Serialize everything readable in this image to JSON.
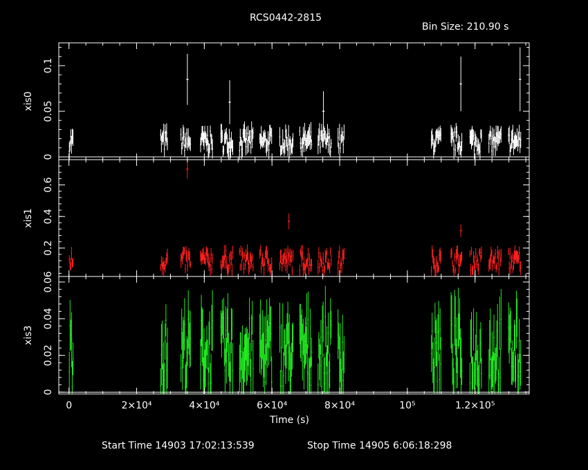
{
  "title": "RCS0442-2815",
  "bin_size_label": "Bin Size: 210.90 s",
  "footer": {
    "start_time": "Start Time 14903 17:02:13:539",
    "stop_time": "Stop Time 14905  6:06:18:298"
  },
  "colors": {
    "axes": "#ffffff",
    "xis0": "#ffffff",
    "xis1": "#ff2020",
    "xis3": "#22ee22"
  },
  "chart_data": {
    "type": "scatter",
    "xlabel": "Time (s)",
    "xlim": [
      -3000,
      136000
    ],
    "x_ticks": [
      {
        "value": 0,
        "label": "0"
      },
      {
        "value": 20000,
        "label": "2×10⁴"
      },
      {
        "value": 40000,
        "label": "4×10⁴"
      },
      {
        "value": 60000,
        "label": "6×10⁴"
      },
      {
        "value": 80000,
        "label": "8×10⁴"
      },
      {
        "value": 100000,
        "label": "10⁵"
      },
      {
        "value": 120000,
        "label": "1.2×10⁵"
      }
    ],
    "segments": [
      [
        0,
        1300
      ],
      [
        27000,
        29200
      ],
      [
        33000,
        36000
      ],
      [
        38800,
        42500
      ],
      [
        44800,
        48500
      ],
      [
        50300,
        54500
      ],
      [
        56300,
        60000
      ],
      [
        62200,
        66300
      ],
      [
        68100,
        71800
      ],
      [
        73500,
        77600
      ],
      [
        79400,
        81400
      ],
      [
        107000,
        110000
      ],
      [
        112800,
        116200
      ],
      [
        118400,
        122000
      ],
      [
        124000,
        127800
      ],
      [
        129800,
        133600
      ]
    ],
    "panels": [
      {
        "name": "xis0",
        "ylabel": "xis0",
        "ylim": [
          -0.003,
          0.125
        ],
        "y_ticks": [
          {
            "value": 0,
            "label": "0"
          },
          {
            "value": 0.05,
            "label": "0.05"
          },
          {
            "value": 0.1,
            "label": "0.1"
          }
        ],
        "mean": 0.017,
        "spread": 0.007,
        "err": 0.008,
        "spikes": [
          {
            "x": 35000,
            "y": 0.085,
            "err": 0.028
          },
          {
            "x": 47500,
            "y": 0.06,
            "err": 0.024
          },
          {
            "x": 75200,
            "y": 0.05,
            "err": 0.022
          },
          {
            "x": 115800,
            "y": 0.08,
            "err": 0.03
          },
          {
            "x": 133300,
            "y": 0.085,
            "err": 0.035
          }
        ]
      },
      {
        "name": "xis1",
        "ylabel": "xis1",
        "ylim": [
          0.02,
          0.76
        ],
        "y_ticks": [
          {
            "value": 0.2,
            "label": "0.2"
          },
          {
            "value": 0.4,
            "label": "0.4"
          },
          {
            "value": 0.6,
            "label": "0.6"
          }
        ],
        "mean": 0.12,
        "spread": 0.04,
        "err": 0.035,
        "spikes": [
          {
            "x": 35000,
            "y": 0.7,
            "err": 0.06
          },
          {
            "x": 65000,
            "y": 0.37,
            "err": 0.05
          },
          {
            "x": 115800,
            "y": 0.31,
            "err": 0.04
          }
        ]
      },
      {
        "name": "xis3",
        "ylabel": "xis3",
        "ylim": [
          -0.001,
          0.063
        ],
        "y_ticks": [
          {
            "value": 0,
            "label": "0"
          },
          {
            "value": 0.02,
            "label": "0.02"
          },
          {
            "value": 0.04,
            "label": "0.04"
          },
          {
            "value": 0.06,
            "label": "0.06"
          }
        ],
        "mean": 0.022,
        "spread": 0.012,
        "err": 0.012,
        "spikes": []
      }
    ]
  }
}
